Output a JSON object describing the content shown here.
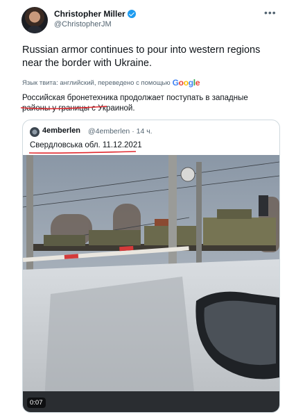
{
  "author": {
    "name": "Christopher Miller",
    "handle": "@ChristopherJM",
    "verified_icon": "verified-badge-icon",
    "avatar_icon": "profile-avatar"
  },
  "menu_icon": "more-options-icon",
  "tweet": {
    "text": "Russian armor continues to pour into western regions near the border with Ukraine.",
    "translated_label": "Язык твита: английский, переведено с помощью",
    "translated_by": "Google",
    "translation": "Российская бронетехника продолжает поступать в западные районы у границы с Украиной."
  },
  "quoted": {
    "name": "4emberlen",
    "handle": "@4emberlen",
    "time": "· 14 ч.",
    "text": "Свердловська обл. 11.12.2021",
    "video_duration": "0:07"
  },
  "colors": {
    "underline": "#e0282e",
    "accent": "#1d9bf0"
  }
}
